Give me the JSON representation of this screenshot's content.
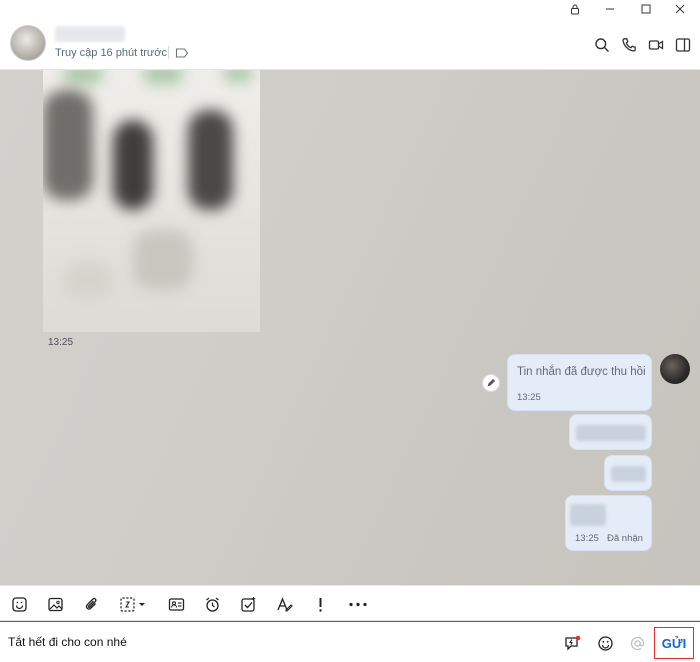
{
  "window": {
    "controls": [
      "lock-icon",
      "minimize-icon",
      "maximize-icon",
      "close-icon"
    ]
  },
  "header": {
    "status": "Truy cập 16 phút trước",
    "actions": [
      "search-icon",
      "phone-icon",
      "video-icon",
      "sidebar-toggle-icon"
    ]
  },
  "messages": {
    "received_time": "13:25",
    "recalled_text": "Tin nhắn đã được thu hồi",
    "recalled_time": "13:25",
    "last_time": "13:25",
    "last_status": "Đã nhận"
  },
  "toolbar": {
    "items": [
      "sticker-icon",
      "image-icon",
      "attach-icon",
      "screenshot-icon",
      "contact-card-icon",
      "reminder-icon",
      "todo-icon",
      "text-format-icon",
      "important-icon",
      "more-icon"
    ]
  },
  "composer": {
    "value": "Tắt hết đi cho con nhé",
    "send_label": "GỬI"
  },
  "colors": {
    "accent": "#1565d8",
    "send_border": "#e0322b",
    "bubble": "#e4ecf7"
  }
}
